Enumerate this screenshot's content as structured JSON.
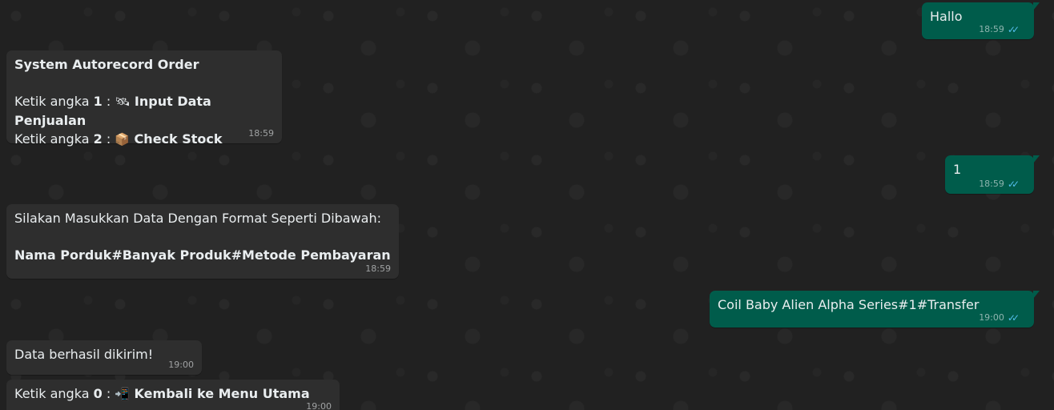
{
  "messages": {
    "hallo": {
      "text": "Hallo",
      "time": "18:59"
    },
    "menu": {
      "title": "System Autorecord Order",
      "line1_prefix": "Ketik angka ",
      "line1_num": "1",
      "line1_sep": " : ",
      "line1_emoji": "🛰",
      "line1_label": " Input Data Penjualan",
      "line2_prefix": "Ketik angka ",
      "line2_num": "2",
      "line2_sep": " : ",
      "line2_emoji": "📦",
      "line2_label": " Check Stock",
      "time": "18:59"
    },
    "one": {
      "text": "1",
      "time": "18:59"
    },
    "format": {
      "line1": "Silakan Masukkan Data Dengan Format Seperti Dibawah:",
      "line2": "Nama Porduk#Banyak Produk#Metode Pembayaran",
      "time": "18:59"
    },
    "coil": {
      "text": "Coil Baby Alien Alpha Series#1#Transfer",
      "time": "19:00"
    },
    "ok": {
      "text": "Data berhasil dikirim!",
      "time": "19:00"
    },
    "back": {
      "prefix": "Ketik angka ",
      "num": "0",
      "sep": " : ",
      "emoji": "📲",
      "label": " Kembali ke Menu Utama",
      "time": "19:00"
    }
  },
  "colors": {
    "incoming": "#2e2e2e",
    "outgoing": "#005c4b",
    "read_ticks": "#53bdeb"
  },
  "icons": {
    "read_receipt": "double-check-icon"
  }
}
